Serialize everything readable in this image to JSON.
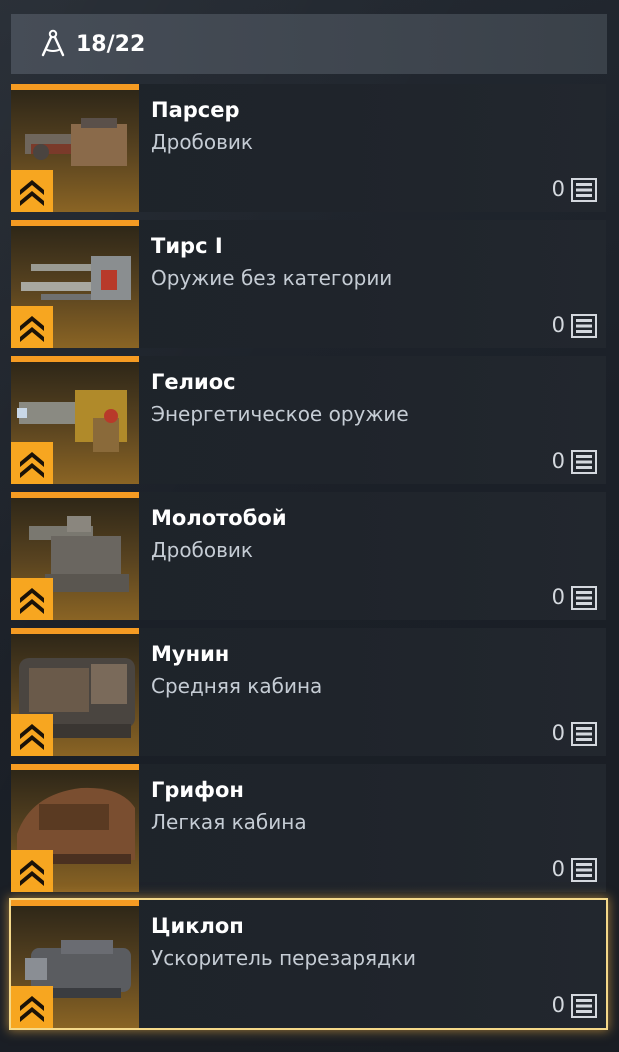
{
  "header": {
    "counter": "18/22",
    "icon": "compass-icon"
  },
  "items": [
    {
      "title": "Парсер",
      "subtitle": "Дробовик",
      "count": "0",
      "selected": false
    },
    {
      "title": "Тирс I",
      "subtitle": "Оружие без категории",
      "count": "0",
      "selected": false
    },
    {
      "title": "Гелиос",
      "subtitle": "Энергетическое оружие",
      "count": "0",
      "selected": false
    },
    {
      "title": "Молотобой",
      "subtitle": "Дробовик",
      "count": "0",
      "selected": false
    },
    {
      "title": "Мунин",
      "subtitle": "Средняя кабина",
      "count": "0",
      "selected": false
    },
    {
      "title": "Грифон",
      "subtitle": "Легкая кабина",
      "count": "0",
      "selected": false
    },
    {
      "title": "Циклоп",
      "subtitle": "Ускоритель перезарядки",
      "count": "0",
      "selected": true
    }
  ],
  "colors": {
    "accent": "#f59b22",
    "rank_badge": "#f7a620",
    "selection_border": "#f5d98a"
  }
}
